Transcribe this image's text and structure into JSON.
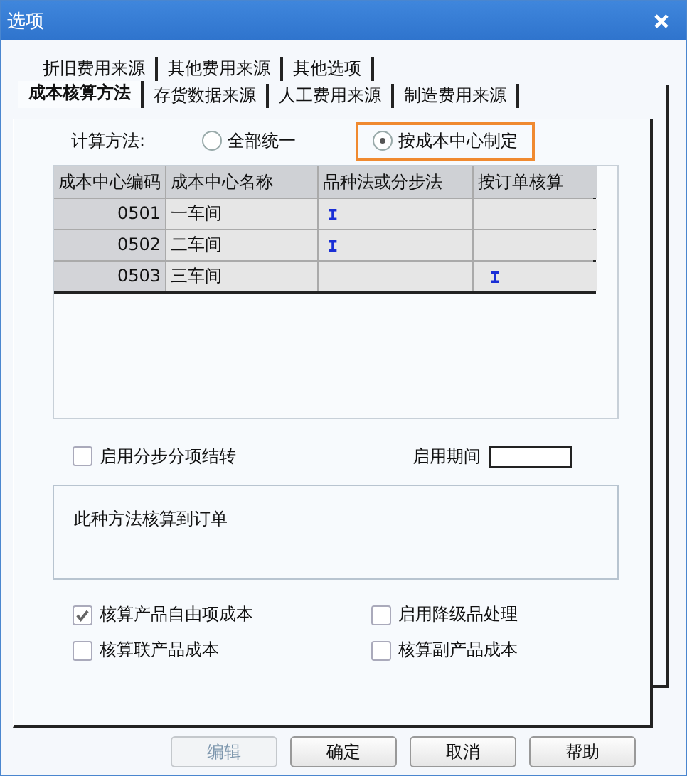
{
  "window": {
    "title": "选项"
  },
  "tab_rows": [
    [
      {
        "label": "折旧费用来源",
        "selected": false
      },
      {
        "label": "其他费用来源",
        "selected": false
      },
      {
        "label": "其他选项",
        "selected": false
      }
    ],
    [
      {
        "label": "成本核算方法",
        "selected": true
      },
      {
        "label": "存货数据来源",
        "selected": false
      },
      {
        "label": "人工费用来源",
        "selected": false
      },
      {
        "label": "制造费用来源",
        "selected": false
      }
    ]
  ],
  "calc_method": {
    "label": "计算方法:",
    "options": [
      {
        "label": "全部统一",
        "selected": false,
        "highlighted": false
      },
      {
        "label": "按成本中心制定",
        "selected": true,
        "highlighted": true
      }
    ]
  },
  "table": {
    "columns": [
      "成本中心编码",
      "成本中心名称",
      "品种法或分步法",
      "按订单核算"
    ],
    "rows": [
      {
        "code": "0501",
        "name": "一车间",
        "variety_or_step": true,
        "by_order": false
      },
      {
        "code": "0502",
        "name": "二车间",
        "variety_or_step": true,
        "by_order": false
      },
      {
        "code": "0503",
        "name": "三车间",
        "variety_or_step": false,
        "by_order": true
      }
    ]
  },
  "step_transfer": {
    "label": "启用分步分项结转",
    "checked": false
  },
  "period": {
    "label": "启用期间"
  },
  "description": "此种方法核算到订单",
  "options": [
    {
      "label": "核算产品自由项成本",
      "checked": true
    },
    {
      "label": "启用降级品处理",
      "checked": false
    },
    {
      "label": "核算联产品成本",
      "checked": false
    },
    {
      "label": "核算副产品成本",
      "checked": false
    }
  ],
  "buttons": [
    {
      "label": "编辑",
      "disabled": true
    },
    {
      "label": "确定",
      "disabled": false
    },
    {
      "label": "取消",
      "disabled": false
    },
    {
      "label": "帮助",
      "disabled": false
    }
  ]
}
